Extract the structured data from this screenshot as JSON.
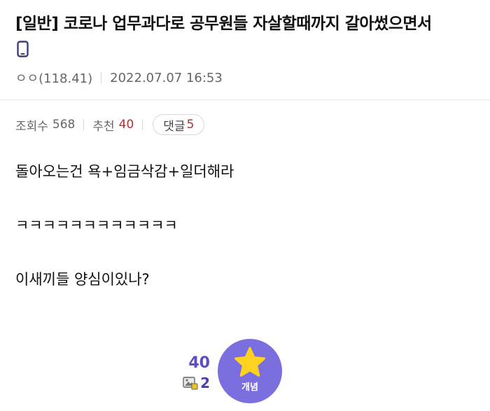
{
  "post": {
    "title": "[일반] 코로나 업무과다로 공무원들 자살할때까지 갈아썼으면서",
    "author": "ㅇㅇ(118.41)",
    "date": "2022.07.07 16:53"
  },
  "stats": {
    "views_label": "조회수",
    "views": "568",
    "recommend_label": "추천",
    "recommend": "40",
    "comments_label": "댓글",
    "comments": "5"
  },
  "content": {
    "line1": "돌아오는건 욕+임금삭감+일더해라",
    "line2": "ㅋㅋㅋㅋㅋㅋㅋㅋㅋㅋㅋㅋ",
    "line3": "이새끼들 양심이있나?"
  },
  "footer": {
    "recommend_count": "40",
    "image_comment_count": "2",
    "star_button_label": "개념"
  },
  "colors": {
    "accent_purple": "#7b6fe0",
    "count_purple": "#5b4fc6",
    "red_number": "#b52f2f",
    "star_yellow": "#ffd21f"
  },
  "icons": [
    "mobile-icon",
    "image-comment-icon",
    "star-icon"
  ]
}
